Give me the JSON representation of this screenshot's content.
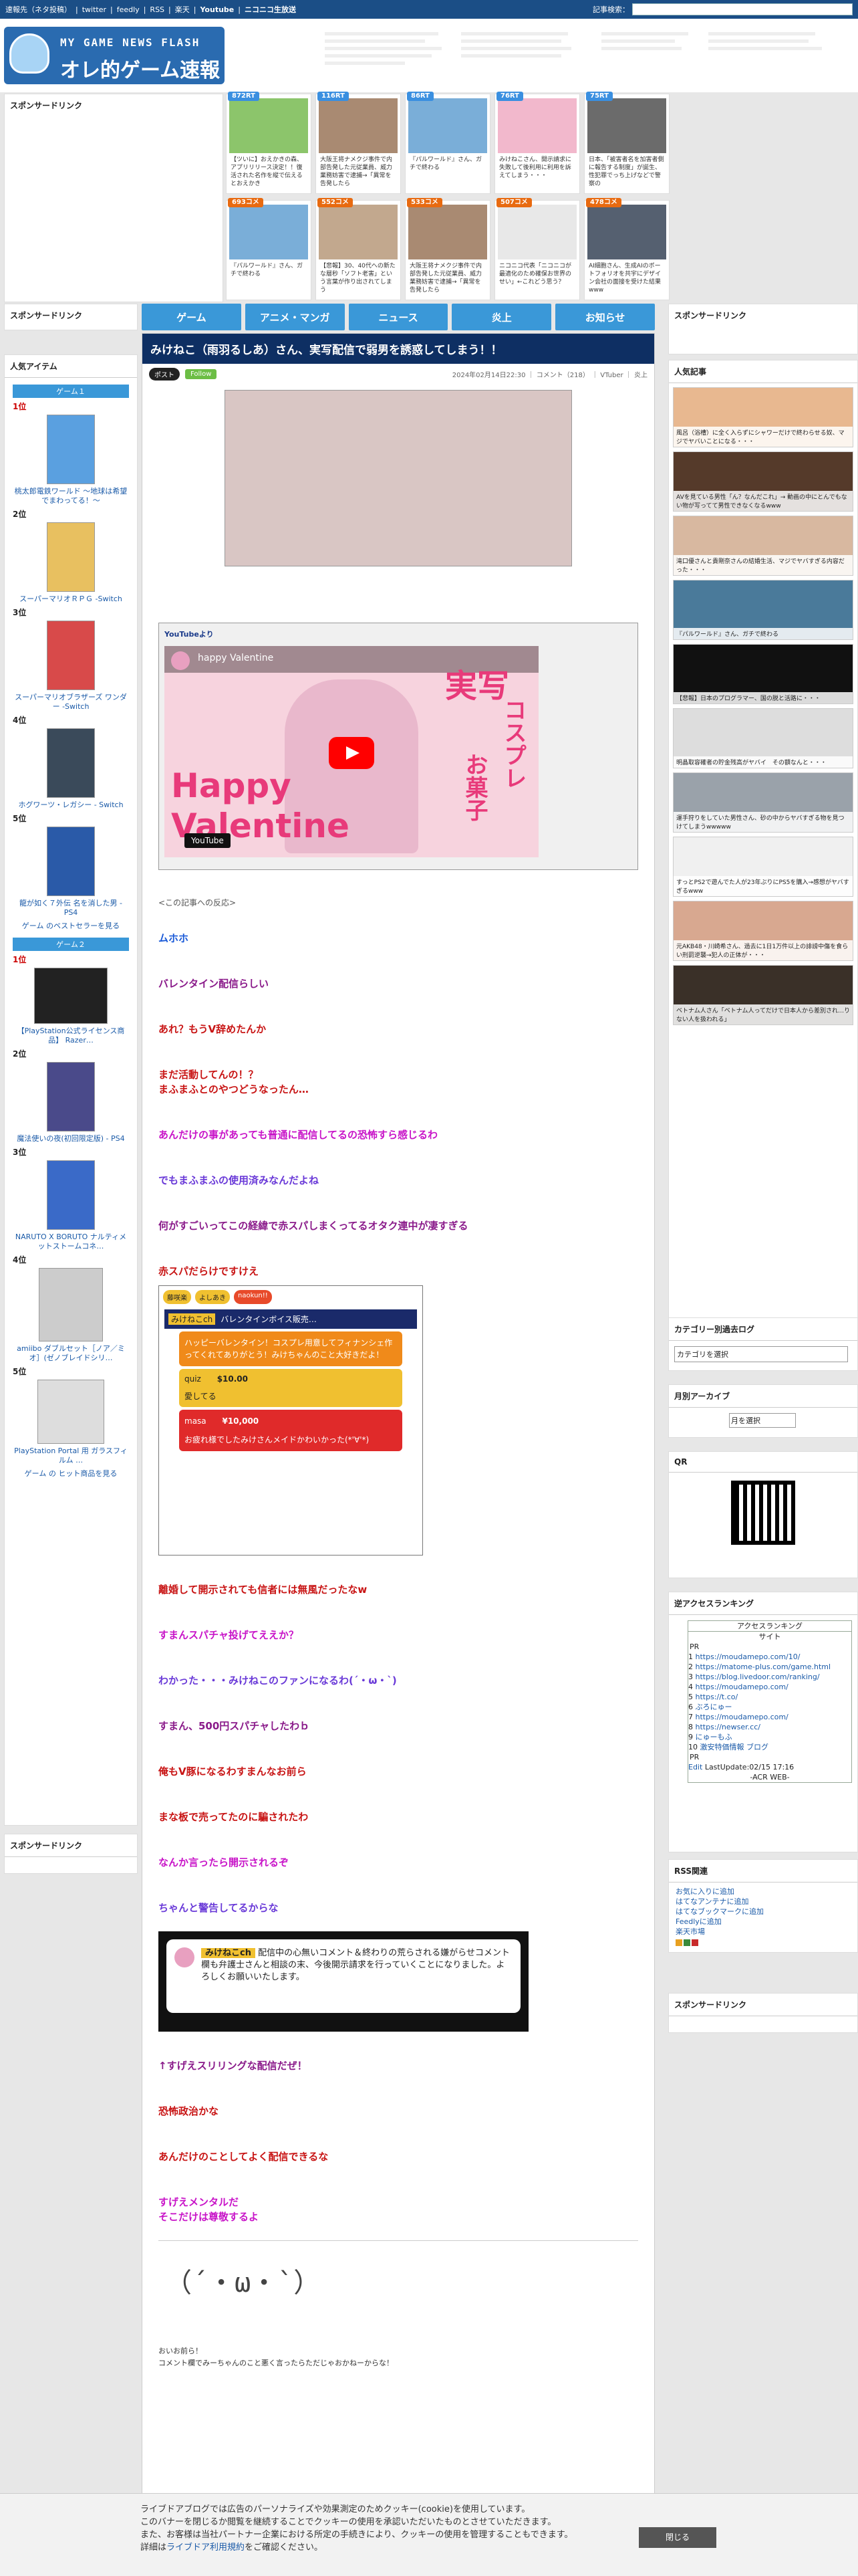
{
  "topbar": {
    "links": [
      "速報先（ネタ投稿）",
      "twitter",
      "feedly",
      "RSS",
      "楽天",
      "Youtube",
      "ニコニコ生放送"
    ],
    "search_label": "記事検索："
  },
  "header": {
    "logo_small": "MY GAME NEWS FLASH",
    "logo_big": "オレ的ゲーム速報@JIN"
  },
  "sponsored": "スポンサードリンク",
  "ranking_cards": [
    {
      "badge": "872RT",
      "caption": "【ツいに】おえかきの森、アプリリリース決定！！復活された名作を縦で伝えるとおえかき"
    },
    {
      "badge": "116RT",
      "caption": "大阪王将ナメクジ事件で内部告発した元従業員、威力業務妨害で逮捕→「異常を告発したら"
    },
    {
      "badge": "86RT",
      "caption": "『パルワールド』さん、ガチで終わる"
    },
    {
      "badge": "76RT",
      "caption": "みけねこさん、開示請求に失敗して後利用に利用を訴えてしまう・・・"
    },
    {
      "badge": "75RT",
      "caption": "日本、「被害者名を加害者側に報告する制度」が誕生、性犯罪でっち上げなどで警察の"
    },
    {
      "badge": "693コメ",
      "caption": "『パルワールド』さん、ガチで終わる"
    },
    {
      "badge": "552コメ",
      "caption": "【悲報】30、40代への新たな層秒「ソフト老害」という言葉が作り出されてしまう"
    },
    {
      "badge": "533コメ",
      "caption": "大阪王将ナメクジ事件で内部告発した元従業員、威力業務妨害で逮捕→「異常を告発したら"
    },
    {
      "badge": "507コメ",
      "caption": "ニコニコ代表「ニコニコが最適化のため確保お世界のせい」←これどう思う？"
    },
    {
      "badge": "478コメ",
      "caption": "AI細胞さん、生成AIのボートフォリオを共宇にデザイン会社の面接を受けた結果www"
    }
  ],
  "nav": [
    "ゲーム",
    "アニメ・マンガ",
    "ニュース",
    "炎上",
    "お知らせ"
  ],
  "left": {
    "title": "人気アイテム",
    "group1": "ゲーム１",
    "items1": [
      {
        "rank": "1位",
        "name": "桃太郎電鉄ワールド ～地球は希望でまわってる！～"
      },
      {
        "rank": "2位",
        "name": "スーパーマリオＲＰＧ -Switch"
      },
      {
        "rank": "3位",
        "name": "スーパーマリオブラザーズ ワンダー -Switch"
      },
      {
        "rank": "4位",
        "name": "ホグワーツ・レガシー - Switch"
      },
      {
        "rank": "5位",
        "name": "龍が如く７外伝 名を消した男 - PS4"
      }
    ],
    "more1": "ゲーム のベストセラーを見る",
    "group2": "ゲーム２",
    "items2": [
      {
        "rank": "1位",
        "name": "【PlayStation公式ライセンス商品】 Razer…"
      },
      {
        "rank": "2位",
        "name": "魔法使いの夜(初回限定版) - PS4"
      },
      {
        "rank": "3位",
        "name": "NARUTO X BORUTO ナルティメットストームコネ…"
      },
      {
        "rank": "4位",
        "name": "amiibo ダブルセット［ノア／ミオ］(ゼノブレイドシリ…"
      },
      {
        "rank": "5位",
        "name": "PlayStation Portal 用 ガラスフィルム …"
      }
    ],
    "more2": "ゲーム の ヒット商品を見る"
  },
  "article": {
    "title": "みけねこ（雨羽るしあ）さん、実写配信で弱男を誘惑してしまう！！",
    "tweet": "ポスト",
    "follow": "Follow",
    "meta": "2024年02月14日22:30 ｜ コメント（218） ｜ VTuber ｜ 炎上",
    "youtube_label": "YouTubeより",
    "video_title": "happy Valentine",
    "video_text_1": "実写",
    "video_text_2": "コスプレ",
    "video_text_3": "お菓子",
    "video_happy": "Happy",
    "video_val": "Valentine",
    "video_brand": "YouTube",
    "reaction_header": "<この記事への反応>",
    "comments_a": [
      {
        "text": "ムホホ",
        "color": "#1a5ad8"
      },
      {
        "text": "バレンタイン配信らしい",
        "color": "#8a1a8a"
      },
      {
        "text": "あれ？もうV辞めたんか",
        "color": "#c81414"
      },
      {
        "text": "まだ活動してんの！？\nまふまふとのやつどうなったん…",
        "color": "#c81414"
      },
      {
        "text": "あんだけの事があっても普通に配信してるの恐怖すら感じるわ",
        "color": "#c814c8"
      },
      {
        "text": "でもまふまふの使用済みなんだよね",
        "color": "#6a3ad8"
      },
      {
        "text": "何がすごいってこの経緯で赤スパしまくってるオタク連中が凄すぎる",
        "color": "#8a1a8a"
      },
      {
        "text": "赤スパだらけですけえ",
        "color": "#c81414"
      }
    ],
    "chat": {
      "tabs": [
        "藤咲楽",
        "よしあき",
        "naokun!!"
      ],
      "header": "みけねこch",
      "header2": "バレンタインボイス販売…",
      "msg1": "ハッピーバレンタイン！コスプレ用意してフィナンシェ作ってくれてありがとう！みけちゃんのこと大好きだよ！",
      "user2": "quiz",
      "amt2": "$10.00",
      "msg2": "愛してる",
      "user3": "masa",
      "amt3": "¥10,000",
      "msg3": "お疲れ様でしたみけさんメイドかわいかった(*'∀'*)"
    },
    "comments_b": [
      {
        "text": "離婚して開示されても信者には無風だったなw",
        "color": "#c81414"
      },
      {
        "text": "すまんスパチャ投げてええか？",
        "color": "#c814c8"
      },
      {
        "text": "わかった・・・みけねこのファンになるわ(´・ω・`)",
        "color": "#6a3ad8"
      },
      {
        "text": "すまん、500円スパチャしたわｂ",
        "color": "#8a1a8a"
      },
      {
        "text": "俺もV豚になるわすまんなお前ら",
        "color": "#c81414"
      },
      {
        "text": "まな板で売ってたのに騙されたわ",
        "color": "#c81414"
      },
      {
        "text": "なんか言ったら開示されるぞ",
        "color": "#c814c8"
      },
      {
        "text": "ちゃんと警告してるからな",
        "color": "#6a3ad8"
      }
    ],
    "warn_name": "みけねこch",
    "warn_text": "配信中の心無いコメント＆終わりの荒らされる嫌がらせコメント欄も弁護士さんと相談の末、今後開示請求を行っていくことになりました。よろしくお願いいたします。",
    "comments_c": [
      {
        "text": "↑すげえスリリングな配信だぜ！",
        "color": "#8a1a8a"
      },
      {
        "text": "恐怖政治かな",
        "color": "#c81414"
      },
      {
        "text": "あんだけのことしてよく配信できるな",
        "color": "#c81414"
      },
      {
        "text": "すげえメンタルだ\nそこだけは尊敬するよ",
        "color": "#c814c8"
      }
    ],
    "aa": "（´・ω・`）",
    "ending_1": "おいお前ら！",
    "ending_2": "コメント欄でみーちゃんのこと悪く言ったらただじゃおかねーからな！"
  },
  "right": {
    "sponsored": "スポンサードリンク",
    "popular_title": "人気記事",
    "popular": [
      "風呂（浴槽）に全く入らずにシャワーだけで終わらせる奴、マジでヤバいことになる・・・",
      "AVを見ている男性「ん？なんだこれ」→ 動画の中にとんでもない物が写ってて男性できなくなるwww",
      "滝口優さんと貴剛奈さんの結婚生活、マジでヤバすぎる内容だった・・・",
      "『パルワールド』さん、ガチで終わる",
      "【悲報】日本のプログラマー、国の脱と活路に・・・",
      "明晶取容確者の貯金残高がヤバイ　その額なんと・・・",
      "運手狩りをしていた男性さん、砂の中からヤバすぎる物を見つけてしまうwwwww",
      "すっとPS2で遊んでた人が23年ぶりにPS5を購入→感想がヤバすぎるwww",
      "元AKB48・川崎希さん、過去に1日1万件以上の誹謗中傷を食らい刑罰逆襲→犯人の正体が・・・",
      "ベトナム人さん「ベトナム人ってだけで日本人から差別され…りない人を扱われる」"
    ],
    "cat_title": "カテゴリー別過去ログ",
    "cat_select": "カテゴリを選択",
    "month_title": "月別アーカイブ",
    "month_select": "月を選択",
    "qr_title": "QR",
    "acr_title": "逆アクセスランキング",
    "acr_head": "アクセスランキング",
    "acr_site": "サイト",
    "acr_rows": [
      "https://moudamepo.com/10/",
      "https://matome-plus.com/game.html",
      "https://blog.livedoor.com/ranking/",
      "https://moudamepo.com/",
      "https://t.co/",
      "ぶろにゅー",
      "https://moudamepo.com/",
      "https://newser.cc/",
      "にゅーもふ",
      "激安特価情報 ブログ"
    ],
    "acr_edit": "Edit",
    "acr_update": "LastUpdate:02/15 17:16",
    "acr_credit": "-ACR WEB-",
    "rss_title": "RSS関連",
    "rss_links": [
      "お気に入りに追加",
      "はてなアンテナに追加",
      "はてなブックマークに追加",
      "Feedlyに追加",
      "楽天市場"
    ],
    "sponsored_bottom": "スポンサードリンク"
  },
  "cookie": {
    "line1": "ライブドアブログでは広告のパーソナライズや効果測定のためクッキー(cookie)を使用しています。",
    "line2": "このバナーを閉じるか閲覧を継続することでクッキーの使用を承認いただいたものとさせていただきます。",
    "line3": "また、お客様は当社パートナー企業における所定の手続きにより、クッキーの使用を管理することもできます。",
    "line4a": "詳細は",
    "line4link": "ライブドア利用規約",
    "line4b": "をご確認ください。",
    "close": "閉じる"
  }
}
